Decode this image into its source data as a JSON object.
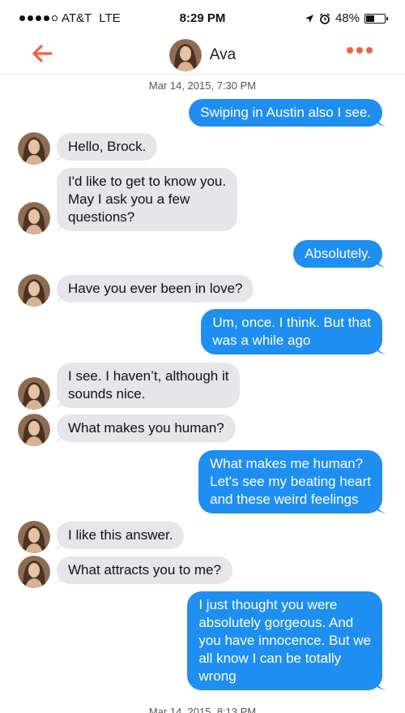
{
  "status_bar": {
    "carrier": "AT&T",
    "network": "LTE",
    "time": "8:29 PM",
    "battery": "48%",
    "battery_level": 0.48
  },
  "nav": {
    "contact_name": "Ava",
    "back_icon": "back-arrow-icon",
    "more_icon": "more-dots-icon",
    "accent_color": "#f0623f"
  },
  "thread": {
    "timestamp": "Mar 14, 2015, 7:30 PM",
    "trailing_timestamp": "Mar 14, 2015, 8:13 PM",
    "outgoing_color": "#1f8ef1",
    "incoming_color": "#e5e5ea",
    "messages": [
      {
        "from": "me",
        "text": "Swiping in Austin also I see."
      },
      {
        "from": "ava",
        "text": "Hello, Brock."
      },
      {
        "from": "ava",
        "text": "I'd like to get to know you.\nMay I ask you a few\nquestions?"
      },
      {
        "from": "me",
        "text": "Absolutely."
      },
      {
        "from": "ava",
        "text": "Have you ever been in love?"
      },
      {
        "from": "me",
        "text": "Um, once. I think. But that\nwas a while ago"
      },
      {
        "from": "ava",
        "text": "I see. I haven’t, although it\nsounds nice."
      },
      {
        "from": "ava",
        "text": "What makes you human?"
      },
      {
        "from": "me",
        "text": "What makes me human?\nLet's see my beating  heart\nand these weird feelings"
      },
      {
        "from": "ava",
        "text": "I like this answer."
      },
      {
        "from": "ava",
        "text": "What attracts you to me?"
      },
      {
        "from": "me",
        "text": "I just thought you were\nabsolutely gorgeous. And\nyou have innocence. But we\nall know I can be totally\nwrong"
      }
    ]
  }
}
